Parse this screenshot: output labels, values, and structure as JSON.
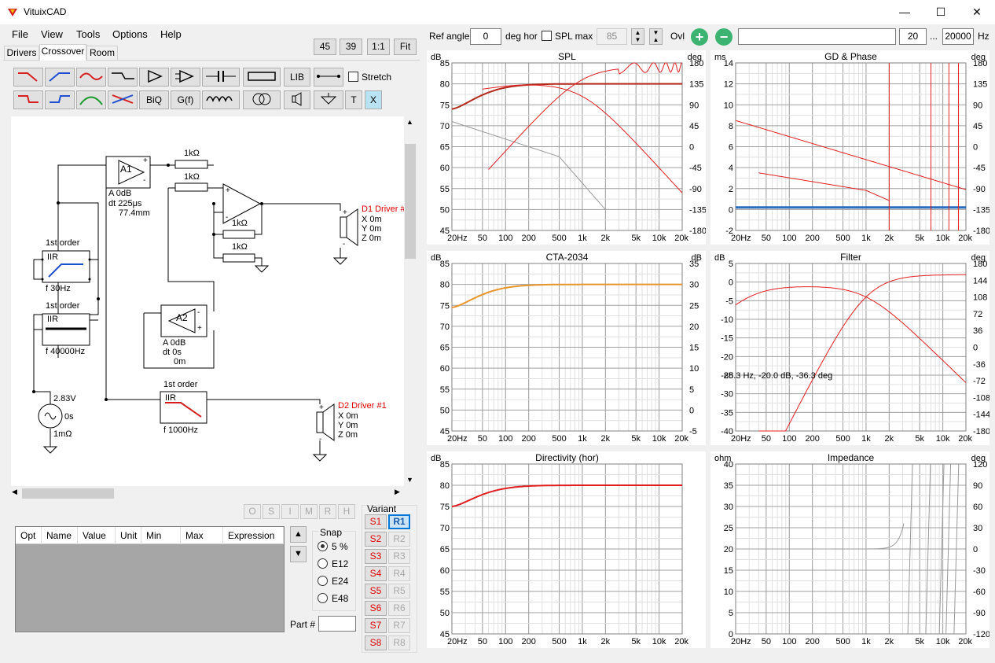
{
  "window": {
    "title": "VituixCAD",
    "minimize": "—",
    "maximize": "☐",
    "close": "✕"
  },
  "menu": [
    "File",
    "View",
    "Tools",
    "Options",
    "Help"
  ],
  "zoom_buttons": [
    "45",
    "39",
    "1:1",
    "Fit"
  ],
  "tabs": [
    "Drivers",
    "Crossover",
    "Room"
  ],
  "active_tab": "Crossover",
  "toolbar": {
    "lib": "LIB",
    "stretch": "Stretch",
    "biq": "BiQ",
    "gf": "G(f)",
    "t": "T",
    "x": "X"
  },
  "schematic": {
    "a1": {
      "label": "A1",
      "gain": "A  0dB",
      "delay": "dt 225μs",
      "distance": "77.4mm"
    },
    "a2": {
      "label": "A2",
      "gain": "A  0dB",
      "delay": "dt 0s",
      "distance": "0m"
    },
    "r1": "1kΩ",
    "r2": "1kΩ",
    "r3": "1kΩ",
    "r4": "1kΩ",
    "hp_filter": {
      "order": "1st order",
      "type": "IIR",
      "freq": "f   30Hz"
    },
    "lp_filter_1": {
      "order": "1st order",
      "type": "IIR",
      "freq": "f   40000Hz"
    },
    "lp_filter_2": {
      "order": "1st order",
      "type": "IIR",
      "freq": "f   1000Hz"
    },
    "source": {
      "voltage": "2.83V",
      "delay": "0s",
      "impedance": "1mΩ"
    },
    "d1": {
      "name": "D1 Driver #",
      "x": "X 0m",
      "y": "Y 0m",
      "z": "Z 0m"
    },
    "d2": {
      "name": "D2 Driver #1",
      "x": "X 0m",
      "y": "Y 0m",
      "z": "Z 0m"
    }
  },
  "osimrh": [
    "O",
    "S",
    "I",
    "M",
    "R",
    "H"
  ],
  "param_table": {
    "columns": [
      "Opt",
      "Name",
      "Value",
      "Unit",
      "Min",
      "Max",
      "Expression"
    ]
  },
  "snap": {
    "title": "Snap",
    "options": [
      "5 %",
      "E12",
      "E24",
      "E48"
    ],
    "selected": "5 %"
  },
  "part_label": "Part #",
  "variant": {
    "title": "Variant",
    "s": [
      "S1",
      "S2",
      "S3",
      "S4",
      "S5",
      "S6",
      "S7",
      "S8"
    ],
    "r": [
      "R1",
      "R2",
      "R3",
      "R4",
      "R5",
      "R6",
      "R7",
      "R8"
    ],
    "active_r": "R1"
  },
  "controls": {
    "ref_angle_label": "Ref angle",
    "ref_angle_value": "0",
    "deg_hor": "deg hor",
    "spl_max_label": "SPL max",
    "spl_max_value": "85",
    "ovl": "Ovl",
    "plus": "+",
    "minus": "−",
    "freq_min": "20",
    "ellipsis": "...",
    "freq_max": "20000",
    "hz": "Hz"
  },
  "colors": {
    "accent_red": "#e02020",
    "dark_red": "#b22a1e",
    "gray_curve": "#9a9a9a",
    "blue_curve": "#2a6fbf",
    "orange_curve": "#e8952c"
  },
  "freq_ticks": [
    "20Hz",
    "50",
    "100",
    "200",
    "500",
    "1k",
    "2k",
    "5k",
    "10k",
    "20k"
  ],
  "charts": [
    {
      "id": "spl",
      "title": "SPL",
      "lunit": "dB",
      "runit": "deg",
      "left_ticks": [
        "85",
        "80",
        "75",
        "70",
        "65",
        "60",
        "55",
        "50",
        "45"
      ],
      "right_ticks": [
        "180",
        "135",
        "90",
        "45",
        "0",
        "-45",
        "-90",
        "-135",
        "-180"
      ]
    },
    {
      "id": "gd",
      "title": "GD & Phase",
      "lunit": "ms",
      "runit": "deg",
      "left_ticks": [
        "14",
        "12",
        "10",
        "8",
        "6",
        "4",
        "2",
        "0",
        "-2"
      ],
      "right_ticks": [
        "180",
        "135",
        "90",
        "45",
        "0",
        "-45",
        "-90",
        "-135",
        "-180"
      ]
    },
    {
      "id": "cta",
      "title": "CTA-2034",
      "lunit": "dB",
      "runit": "dB",
      "left_ticks": [
        "85",
        "80",
        "75",
        "70",
        "65",
        "60",
        "55",
        "50",
        "45"
      ],
      "right_ticks": [
        "35",
        "30",
        "25",
        "20",
        "15",
        "10",
        "5",
        "0",
        "-5"
      ]
    },
    {
      "id": "filter",
      "title": "Filter",
      "lunit": "dB",
      "runit": "deg",
      "left_ticks": [
        "5",
        "0",
        "-5",
        "-10",
        "-15",
        "-20",
        "-25",
        "-30",
        "-35",
        "-40"
      ],
      "right_ticks": [
        "180",
        "144",
        "108",
        "72",
        "36",
        "0",
        "-36",
        "-72",
        "-108",
        "-144",
        "-180"
      ],
      "annotation": "88.3 Hz, -20.0 dB, -36.3 deg"
    },
    {
      "id": "dir",
      "title": "Directivity (hor)",
      "lunit": "dB",
      "runit": "",
      "left_ticks": [
        "85",
        "80",
        "75",
        "70",
        "65",
        "60",
        "55",
        "50",
        "45"
      ],
      "right_ticks": []
    },
    {
      "id": "imp",
      "title": "Impedance",
      "lunit": "ohm",
      "runit": "deg",
      "left_ticks": [
        "40",
        "35",
        "30",
        "25",
        "20",
        "15",
        "10",
        "5",
        "0"
      ],
      "right_ticks": [
        "120",
        "90",
        "60",
        "30",
        "0",
        "-30",
        "-60",
        "-90",
        "-120"
      ]
    }
  ]
}
